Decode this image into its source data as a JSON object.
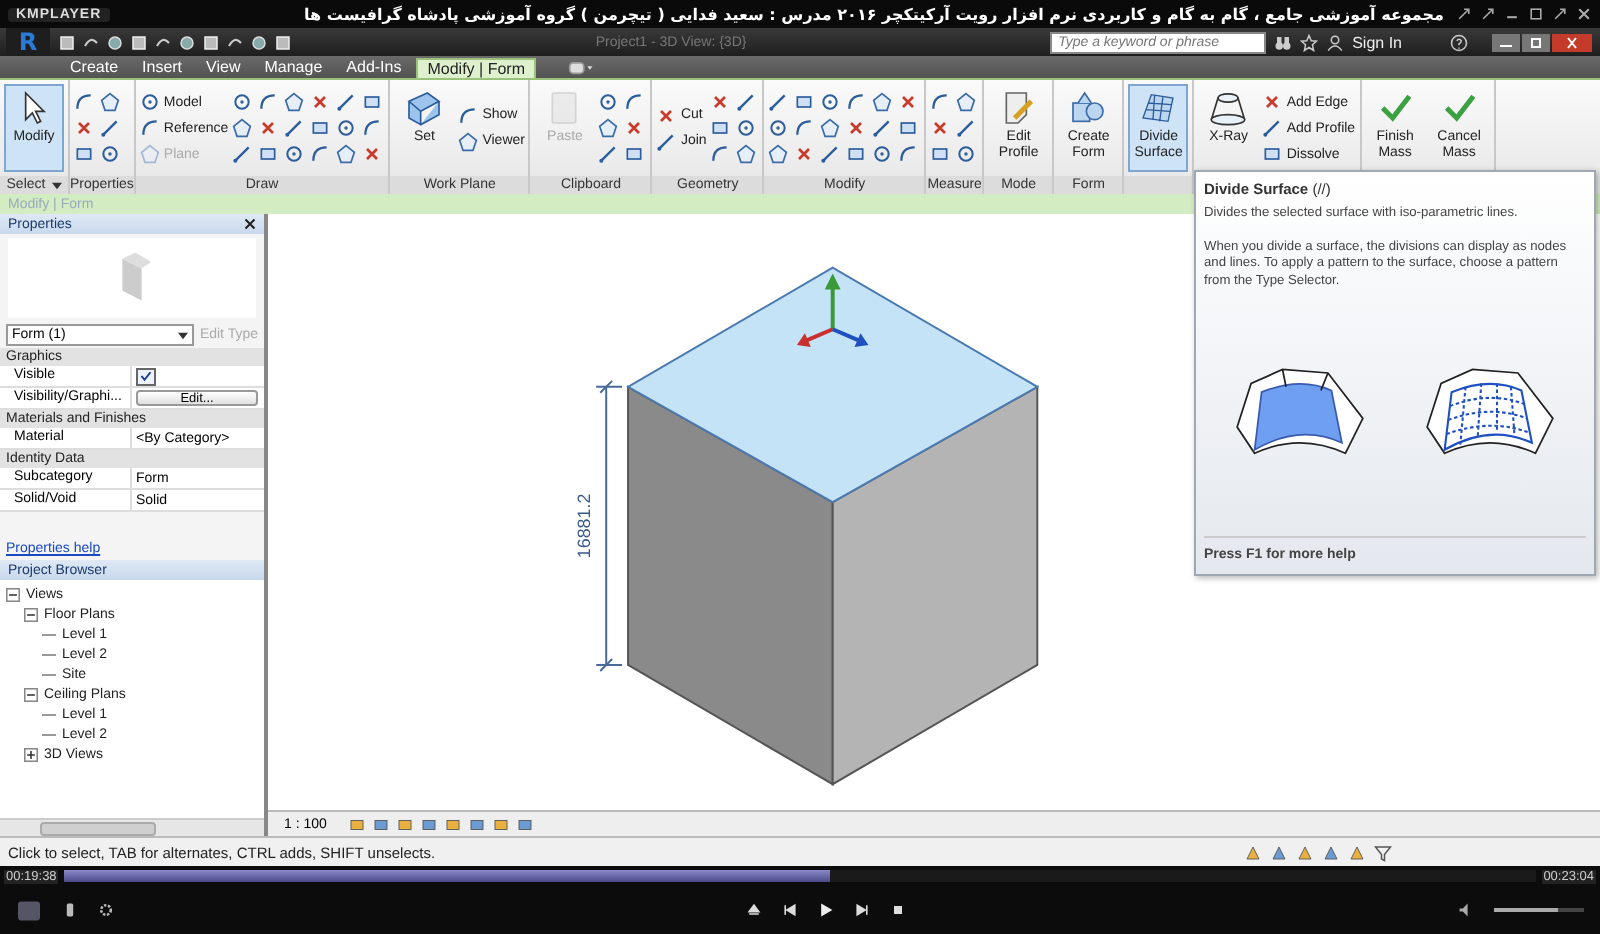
{
  "player": {
    "logo": "KMPLAYER",
    "title": "مجموعه آموزشی جامع ، گام به گام و کاربردی نرم افزار رویت آرکیتکچر ۲۰۱۶   مدرس : سعید فدایی ( تیچرمن ) گروه آموزشی پادشاه گرافیست ها",
    "elapsed": "00:19:38",
    "total": "00:23:04",
    "level": 0.52,
    "volume": {
      "level": 0.7
    }
  },
  "app": {
    "app_button": "R",
    "doc_title": "Project1 - 3D View: {3D}",
    "search": {
      "placeholder": "Type a keyword or phrase"
    },
    "sign_in": "Sign In"
  },
  "tabs": [
    {
      "label": "Create",
      "selected": false
    },
    {
      "label": "Insert",
      "selected": false
    },
    {
      "label": "View",
      "selected": false
    },
    {
      "label": "Manage",
      "selected": false
    },
    {
      "label": "Add-Ins",
      "selected": false
    },
    {
      "label": "Modify | Form",
      "selected": true
    }
  ],
  "ribbon": [
    {
      "label": "Select",
      "dropdown": true,
      "tools": [
        {
          "kind": "large",
          "label": "Modify",
          "selected": true
        }
      ]
    },
    {
      "label": "Properties",
      "tools": [
        {
          "kind": "grid",
          "disabled": false
        }
      ]
    },
    {
      "label": "Draw",
      "tools": [
        {
          "kind": "stack",
          "items": [
            {
              "label": "Model",
              "disabled": false
            },
            {
              "label": "Reference",
              "disabled": false
            },
            {
              "label": "Plane",
              "disabled": true
            }
          ]
        },
        {
          "kind": "grid",
          "disabled": false
        },
        {
          "kind": "grid",
          "disabled": false
        },
        {
          "kind": "grid",
          "disabled": false
        }
      ]
    },
    {
      "label": "Work Plane",
      "tools": [
        {
          "kind": "large",
          "label": "Set",
          "selected": false
        },
        {
          "kind": "stack",
          "items": [
            {
              "label": "Show",
              "disabled": false
            },
            {
              "label": "Viewer",
              "disabled": false
            }
          ]
        }
      ]
    },
    {
      "label": "Clipboard",
      "tools": [
        {
          "kind": "large",
          "label": "Paste",
          "selected": false,
          "disabled": true
        },
        {
          "kind": "grid",
          "disabled": false
        }
      ]
    },
    {
      "label": "Geometry",
      "tools": [
        {
          "kind": "stack",
          "items": [
            {
              "label": "Cut",
              "disabled": false
            },
            {
              "label": "Join",
              "disabled": false
            }
          ]
        },
        {
          "kind": "grid",
          "disabled": false
        }
      ]
    },
    {
      "label": "Modify",
      "tools": [
        {
          "kind": "grid",
          "disabled": false
        },
        {
          "kind": "grid",
          "disabled": false
        },
        {
          "kind": "grid",
          "disabled": false
        }
      ]
    },
    {
      "label": "Measure",
      "tools": [
        {
          "kind": "grid",
          "disabled": false
        }
      ]
    },
    {
      "label": "Mode",
      "tools": [
        {
          "kind": "large",
          "label": "Edit Profile",
          "selected": false
        }
      ]
    },
    {
      "label": "Form",
      "tools": [
        {
          "kind": "large",
          "label": "Create Form",
          "selected": false
        }
      ]
    },
    {
      "tools": [
        {
          "kind": "large",
          "label": "Divide Surface",
          "selected": true
        }
      ]
    },
    {
      "tools": [
        {
          "kind": "large",
          "label": "X-Ray",
          "selected": false
        },
        {
          "kind": "stack",
          "items": [
            {
              "label": "Add Edge",
              "disabled": false
            },
            {
              "label": "Add Profile",
              "disabled": false
            },
            {
              "label": "Dissolve",
              "disabled": false
            }
          ]
        }
      ]
    },
    {
      "tools": [
        {
          "kind": "large",
          "label": "Finish Mass",
          "selected": false
        },
        {
          "kind": "large",
          "label": "Cancel Mass",
          "selected": false
        }
      ]
    }
  ],
  "context_bar": "Modify | Form",
  "properties": {
    "title": "Properties",
    "type": "Form (1)",
    "edit_type": "Edit Type",
    "groups": [
      {
        "name": "Graphics",
        "rows": [
          {
            "kind": "check",
            "name": "Visible",
            "checked": true
          },
          {
            "kind": "button",
            "name": "Visibility/Graphi...",
            "value": "Edit..."
          }
        ]
      },
      {
        "name": "Materials and Finishes",
        "rows": [
          {
            "kind": "text",
            "name": "Material",
            "value": "<By Category>"
          }
        ]
      },
      {
        "name": "Identity Data",
        "rows": [
          {
            "kind": "text",
            "name": "Subcategory",
            "value": "Form"
          },
          {
            "kind": "text",
            "name": "Solid/Void",
            "value": "Solid"
          }
        ]
      }
    ],
    "help": "Properties help"
  },
  "browser": {
    "title": "Project Browser",
    "tree": [
      {
        "label": "Views",
        "expanded": true,
        "children": [
          {
            "label": "Floor Plans",
            "expanded": true,
            "children": [
              {
                "label": "Level 1"
              },
              {
                "label": "Level 2"
              },
              {
                "label": "Site"
              }
            ]
          },
          {
            "label": "Ceiling Plans",
            "expanded": true,
            "children": [
              {
                "label": "Level 1"
              },
              {
                "label": "Level 2"
              }
            ]
          },
          {
            "label": "3D Views",
            "expanded": false
          }
        ]
      }
    ]
  },
  "viewport": {
    "dimension": "16881.2",
    "scale": "1 : 100"
  },
  "tooltip": {
    "title": "**Divide Surface** (//)",
    "summary": "Divides the selected surface with iso-parametric lines.",
    "detail": "When you divide a surface, the divisions can display as nodes and lines. To apply a pattern to the surface, choose a pattern from the Type Selector.",
    "help": "Press F1 for more help"
  },
  "status": "Click to select, TAB for alternates, CTRL adds, SHIFT unselects."
}
